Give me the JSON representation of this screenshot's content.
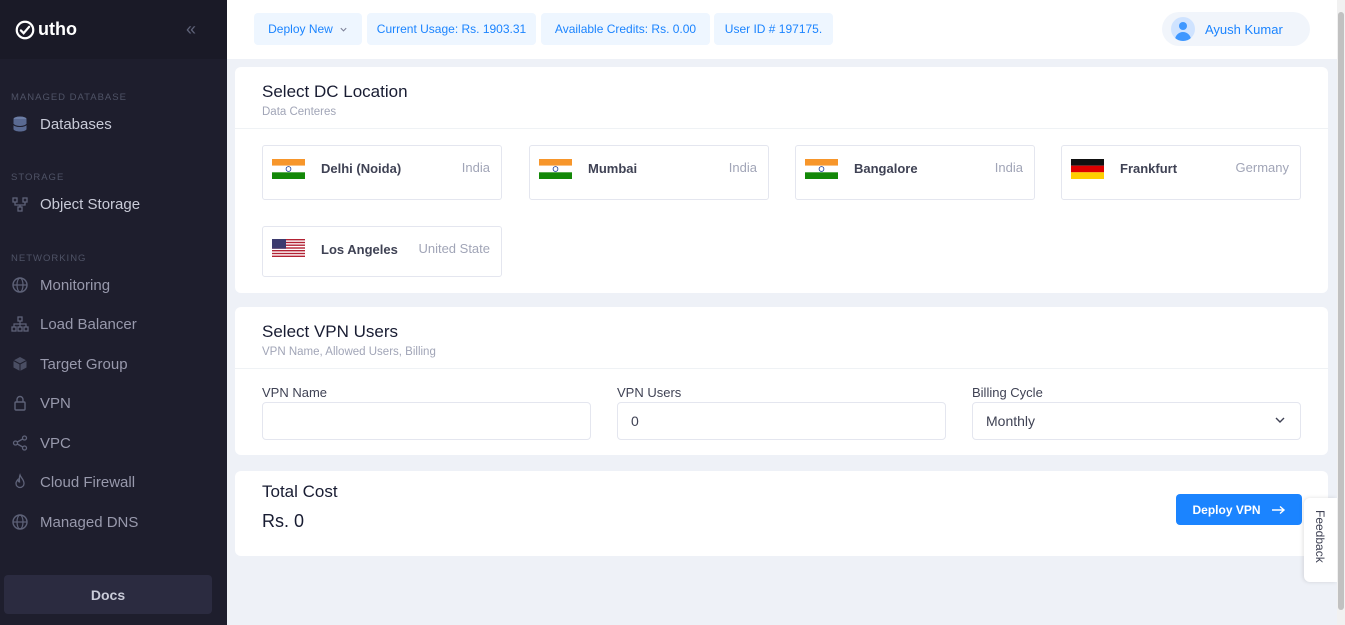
{
  "brand": {
    "name": "utho"
  },
  "sidebar": {
    "sections": [
      {
        "title": "MANAGED DATABASE"
      },
      {
        "title": "STORAGE"
      },
      {
        "title": "NETWORKING"
      }
    ],
    "items": [
      {
        "label": "Databases",
        "icon": "database-icon"
      },
      {
        "label": "Object Storage",
        "icon": "object-storage-icon"
      },
      {
        "label": "Monitoring",
        "icon": "globe-icon"
      },
      {
        "label": "Load Balancer",
        "icon": "load-balancer-icon"
      },
      {
        "label": "Target Group",
        "icon": "cube-icon"
      },
      {
        "label": "VPN",
        "icon": "lock-icon"
      },
      {
        "label": "VPC",
        "icon": "share-icon"
      },
      {
        "label": "Cloud Firewall",
        "icon": "fire-icon"
      },
      {
        "label": "Managed DNS",
        "icon": "globe-icon"
      }
    ],
    "docs": "Docs"
  },
  "topbar": {
    "deploy_new": "Deploy New",
    "current_usage": "Current Usage: Rs. 1903.31",
    "available_credits": "Available Credits: Rs. 0.00",
    "user_id": "User ID # 197175.",
    "user_name": "Ayush Kumar"
  },
  "dc": {
    "title": "Select DC Location",
    "subtitle": "Data Centeres",
    "locations": [
      {
        "city": "Delhi (Noida)",
        "country": "India",
        "flag": "india-flag-icon"
      },
      {
        "city": "Mumbai",
        "country": "India",
        "flag": "india-flag-icon"
      },
      {
        "city": "Bangalore",
        "country": "India",
        "flag": "india-flag-icon"
      },
      {
        "city": "Frankfurt",
        "country": "Germany",
        "flag": "germany-flag-icon"
      },
      {
        "city": "Los Angeles",
        "country": "United State",
        "flag": "usa-flag-icon"
      }
    ]
  },
  "vpn": {
    "title": "Select VPN Users",
    "subtitle": "VPN Name, Allowed Users, Billing",
    "name_label": "VPN Name",
    "name_value": "",
    "users_label": "VPN Users",
    "users_value": "0",
    "billing_label": "Billing Cycle",
    "billing_value": "Monthly"
  },
  "cost": {
    "title": "Total Cost",
    "value": "Rs. 0",
    "deploy": "Deploy VPN"
  },
  "feedback": "Feedback",
  "colors": {
    "accent": "#1b84ff",
    "sidebar": "#1e1e2d"
  }
}
